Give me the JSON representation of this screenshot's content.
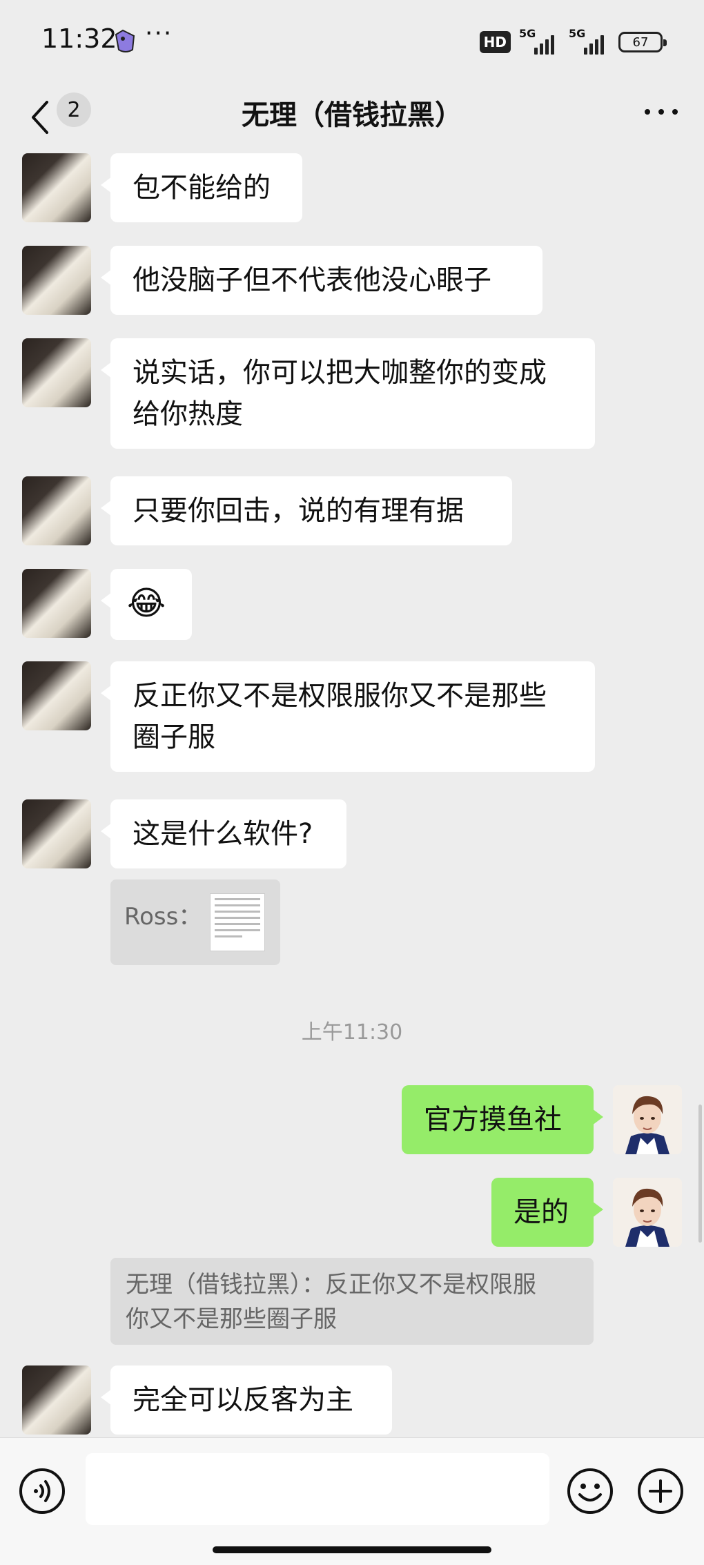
{
  "status_bar": {
    "time": "11:32",
    "more": "···",
    "hd_label": "HD",
    "network_1": "5G",
    "network_2": "5G",
    "battery": "67"
  },
  "nav": {
    "unread_count": "2",
    "title": "无理（借钱拉黑）"
  },
  "messages": [
    {
      "side": "left",
      "text": "包不能给的"
    },
    {
      "side": "left",
      "text": "他没脑子但不代表他没心眼子"
    },
    {
      "side": "left",
      "text_line1": "说实话，你可以把大咖整你的变成",
      "text_line2": "给你热度"
    },
    {
      "side": "left",
      "text": "只要你回击，说的有理有据"
    },
    {
      "side": "left",
      "text": "😂"
    },
    {
      "side": "left",
      "text_line1": "反正你又不是权限服你又不是那些",
      "text_line2": "圈子服"
    },
    {
      "side": "left",
      "text": "这是什么软件?"
    },
    {
      "side": "left",
      "quote_author": "Ross："
    },
    {
      "timestamp": "上午11:30"
    },
    {
      "side": "right",
      "text": "官方摸鱼社"
    },
    {
      "side": "right",
      "text": "是的"
    },
    {
      "side": "right",
      "quote_line1": "无理（借钱拉黑）：反正你又不是权限服",
      "quote_line2": "你又不是那些圈子服"
    },
    {
      "side": "left",
      "text": "完全可以反客为主"
    }
  ],
  "input": {
    "placeholder": ""
  },
  "colors": {
    "background": "#ededed",
    "bubble_self": "#95ec69",
    "bubble_other": "#ffffff",
    "quote_bg": "#dcdcdc"
  },
  "icons": {
    "back": "chevron-left-icon",
    "more": "more-dots-icon",
    "voice": "voice-icon",
    "emoji": "emoji-smile-icon",
    "plus": "plus-circle-icon"
  }
}
